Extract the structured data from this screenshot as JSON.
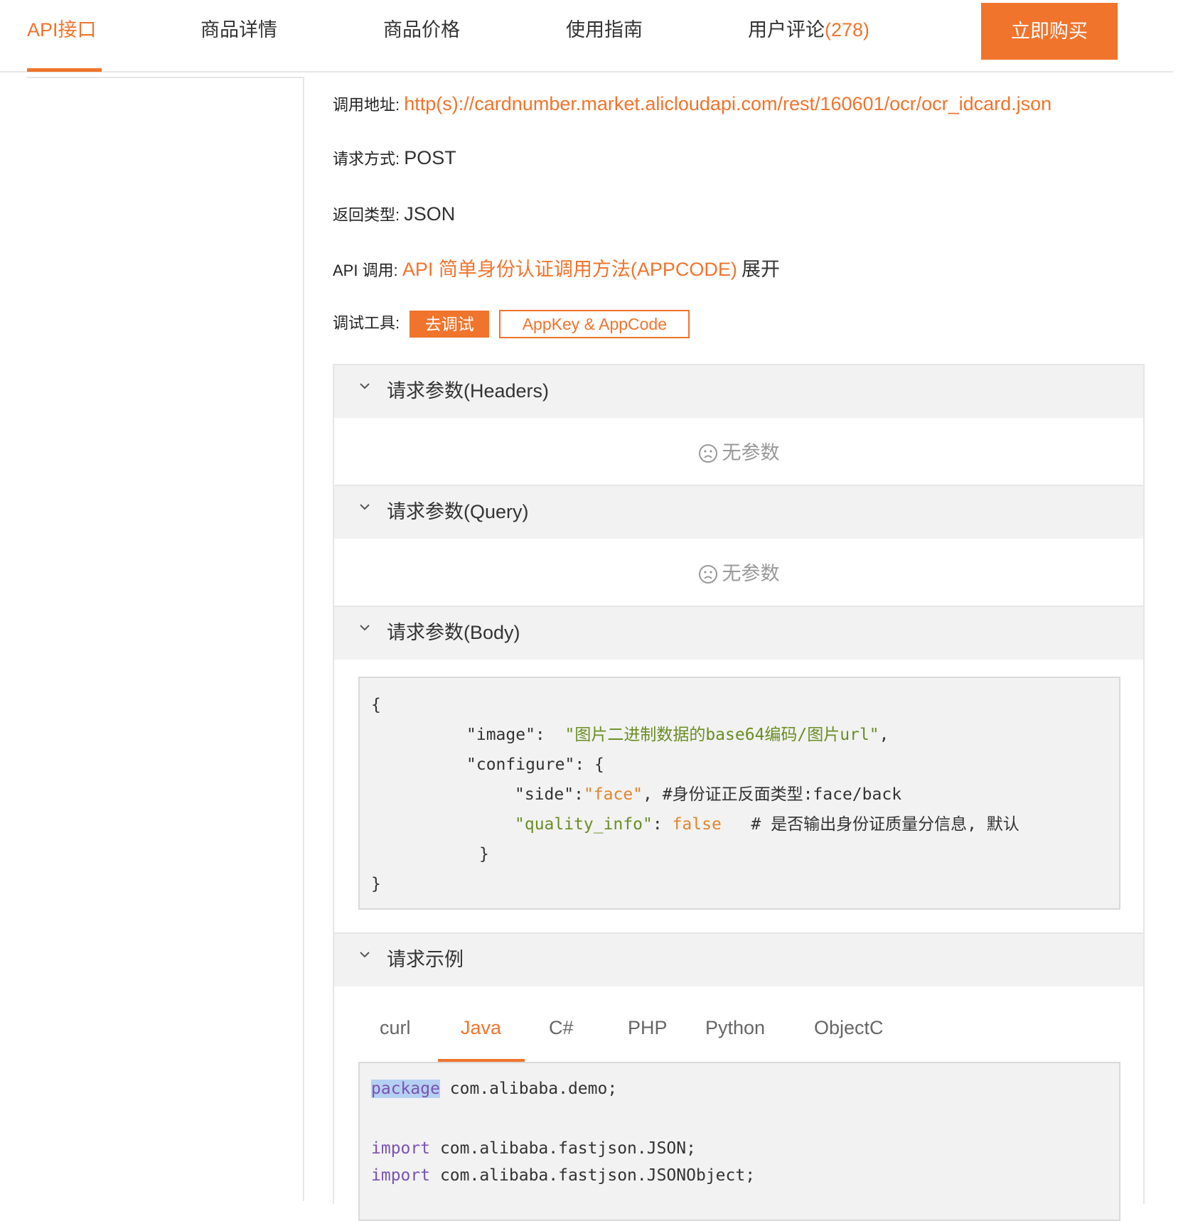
{
  "nav": {
    "tabs": [
      {
        "label": "API接口"
      },
      {
        "label": "商品详情"
      },
      {
        "label": "商品价格"
      },
      {
        "label": "使用指南"
      },
      {
        "label": "用户评论",
        "count": "(278)"
      }
    ],
    "buy_label": "立即购买"
  },
  "info": {
    "url_label": "调用地址:",
    "url_value": "http(s)://cardnumber.market.alicloudapi.com/rest/160601/ocr/ocr_idcard.json",
    "method_label": "请求方式:",
    "method_value": "POST",
    "return_label": "返回类型:",
    "return_value": "JSON",
    "api_label": "API 调用:",
    "api_link": "API 简单身份认证调用方法(APPCODE)",
    "api_expand": "展开",
    "tools_label": "调试工具:",
    "debug_btn": "去调试",
    "key_btn": "AppKey & AppCode"
  },
  "sections": {
    "headers_title": "请求参数(Headers)",
    "query_title": "请求参数(Query)",
    "body_title": "请求参数(Body)",
    "example_title": "请求示例",
    "no_params": "无参数"
  },
  "body_code": {
    "l1": "{",
    "l2_key": "\"image\":",
    "l2_val": "\"图片二进制数据的base64编码/图片url\"",
    "l2_comma": ",",
    "l3": "\"configure\": {",
    "l4_key": "\"side\":",
    "l4_val": "\"face\"",
    "l4_comment": ", #身份证正反面类型:face/back",
    "l5_key": "\"quality_info\"",
    "l5_colon": ": ",
    "l5_val": "false",
    "l5_comment": "   # 是否输出身份证质量分信息, 默认",
    "l6": "}",
    "l7": "}"
  },
  "lang_tabs": [
    "curl",
    "Java",
    "C#",
    "PHP",
    "Python",
    "ObjectC"
  ],
  "java_code": {
    "kw_package": "package",
    "pkg_rest": " com.alibaba.demo;",
    "kw_import1": "import",
    "import1_rest": " com.alibaba.fastjson.JSON;",
    "kw_import2": "import",
    "import2_rest": " com.alibaba.fastjson.JSONObject;"
  },
  "colors": {
    "accent": "#f0742c",
    "panel_header": "#f2f2f2",
    "code_bg": "#f2f2f2",
    "string": "#6b8e23",
    "keyword": "#7a52b3"
  }
}
